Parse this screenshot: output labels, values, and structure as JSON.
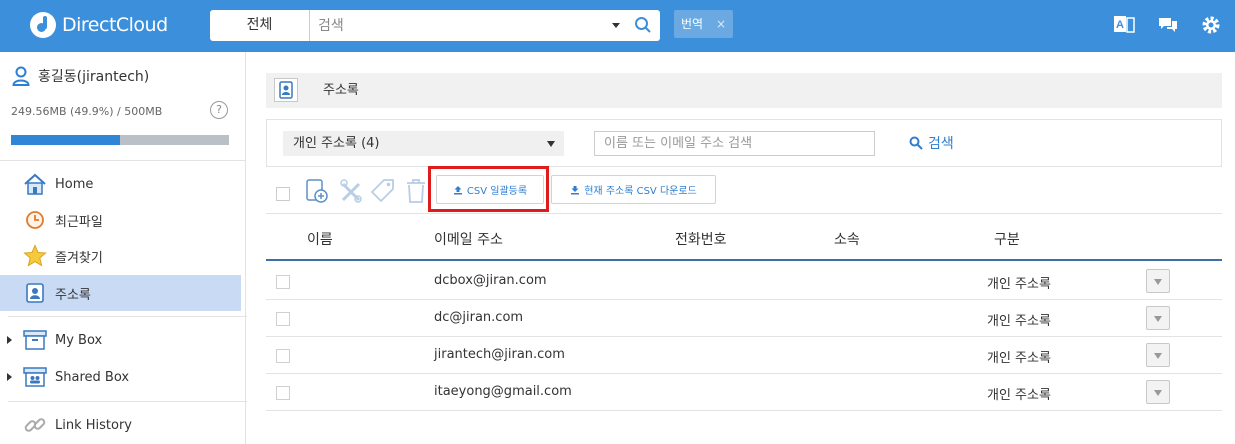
{
  "app": {
    "name": "DirectCloud"
  },
  "search": {
    "scope": "전체",
    "placeholder": "검색"
  },
  "translate_chip": {
    "label": "번역",
    "close": "×"
  },
  "user": {
    "name": "홍길동(jirantech)",
    "quota_text": "249.56MB (49.9%) / 500MB",
    "quota_fraction": 0.499,
    "help": "?"
  },
  "sidebar": {
    "items": [
      {
        "label": "Home"
      },
      {
        "label": "최근파일"
      },
      {
        "label": "즐겨찾기"
      },
      {
        "label": "주소록"
      },
      {
        "label": "My Box"
      },
      {
        "label": "Shared Box"
      },
      {
        "label": "Link History"
      }
    ]
  },
  "main": {
    "title": "주소록",
    "filter": {
      "select_value": "개인 주소록 (4)",
      "search_placeholder": "이름 또는 이메일 주소 검색",
      "search_label": "검색"
    },
    "toolbar": {
      "csv_upload": "CSV 일괄등록",
      "csv_download": "현재 주소록 CSV 다운로드"
    },
    "table": {
      "columns": [
        "이름",
        "이메일 주소",
        "전화번호",
        "소속",
        "구분"
      ],
      "rows": [
        {
          "name": "",
          "email": "dcbox@jiran.com",
          "phone": "",
          "org": "",
          "type": "개인 주소록"
        },
        {
          "name": "",
          "email": "dc@jiran.com",
          "phone": "",
          "org": "",
          "type": "개인 주소록"
        },
        {
          "name": "",
          "email": "jirantech@jiran.com",
          "phone": "",
          "org": "",
          "type": "개인 주소록"
        },
        {
          "name": "",
          "email": "itaeyong@gmail.com",
          "phone": "",
          "org": "",
          "type": "개인 주소록"
        }
      ]
    }
  },
  "colors": {
    "brand": "#3b8fdb",
    "accent": "#2f7fd0",
    "active_nav": "#c9daf4",
    "highlight": "#e01b1b"
  }
}
